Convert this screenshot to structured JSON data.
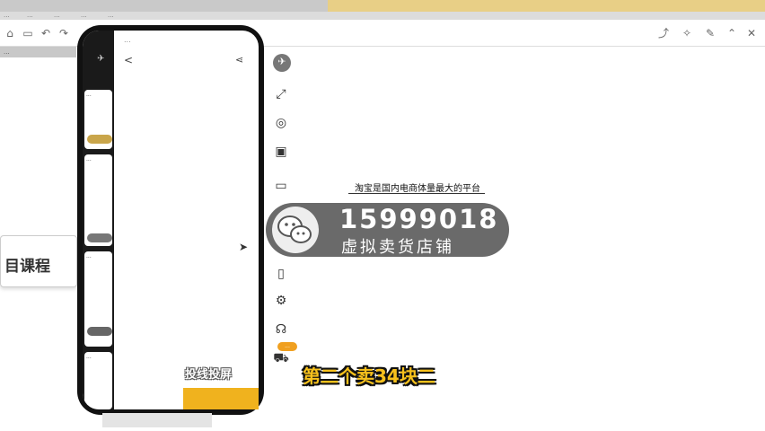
{
  "app": {
    "tab_label": "...",
    "menu_items": [
      "...",
      "...",
      "...",
      "...",
      "..."
    ]
  },
  "left_panel": {
    "course_label": "目课程"
  },
  "phone": {
    "status_text": "...",
    "nav_back": "<",
    "left_cards": [
      "...",
      "...",
      "...",
      "..."
    ],
    "cast_button_label": "投线投屏"
  },
  "toolbar": {
    "icons": [
      "pin-icon",
      "fullscreen-icon",
      "screenshot-icon",
      "record-icon",
      "display-icon",
      "tablet-icon",
      "settings-icon",
      "support-icon",
      "cart-icon"
    ],
    "cart_badge": "..."
  },
  "ad": {
    "subtitle": "淘宝是国内电商体量最大的平台",
    "number": "15999018",
    "tagline": "虚拟卖货店铺"
  },
  "caption": {
    "text": "第二个卖34块二"
  },
  "colors": {
    "accent_yellow": "#f0b21e",
    "caption_yellow": "#f7c11c",
    "banner_gray": "#505050"
  }
}
